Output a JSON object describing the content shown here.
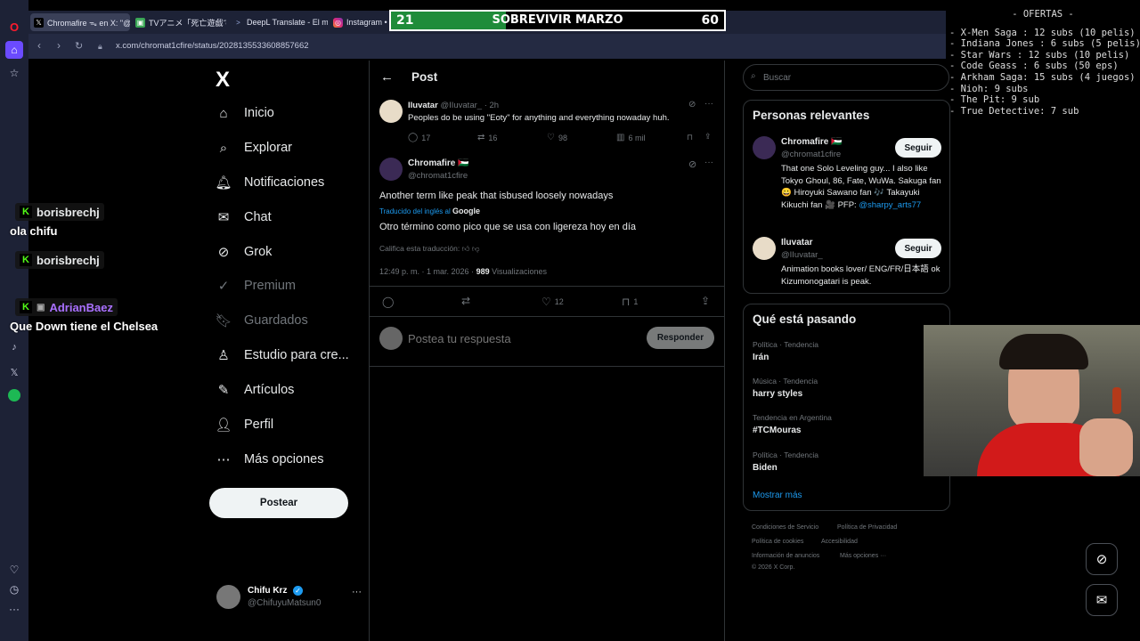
{
  "browser": {
    "tabs": [
      {
        "label": "Chromafire ᯓ en X: \"@IIu",
        "active": true,
        "icon": "x-icon"
      },
      {
        "label": "TVアニメ「死亡遊戯で飯を食",
        "active": false,
        "icon": "tv-icon"
      },
      {
        "label": "DeepL Translate - El mejor",
        "active": false,
        "icon": "deepl-icon"
      },
      {
        "label": "Instagram • M",
        "active": false,
        "icon": "instagram-icon"
      }
    ],
    "url": "x.com/chromat1cfire/status/2028135533608857662"
  },
  "score_bar": {
    "title": "SOBREVIVIR MARZO",
    "current": "21",
    "target": "60",
    "progress_fraction": 0.345,
    "fill_color": "#1f8c3a"
  },
  "offers": {
    "title": "- OFERTAS -",
    "lines": [
      "- X-Men Saga : 12 subs (10 pelis)",
      "- Indiana Jones : 6 subs (5 pelis)",
      "- Star Wars : 12 subs (10 pelis)",
      "- Code Geass : 6 subs (50 eps)",
      "- Arkham Saga: 15 subs (4 juegos)",
      "- Nioh: 9 subs",
      "- The Pit: 9 sub",
      "- True Detective: 7 sub"
    ]
  },
  "nav": {
    "logo": "X",
    "items": [
      {
        "label": "Inicio",
        "icon": "home-icon"
      },
      {
        "label": "Explorar",
        "icon": "search-icon"
      },
      {
        "label": "Notificaciones",
        "icon": "bell-icon"
      },
      {
        "label": "Chat",
        "icon": "mail-icon"
      },
      {
        "label": "Grok",
        "icon": "grok-icon"
      },
      {
        "label": "Premium",
        "icon": "premium-icon"
      },
      {
        "label": "Guardados",
        "icon": "bookmark-icon"
      },
      {
        "label": "Estudio para cre...",
        "icon": "studio-icon"
      },
      {
        "label": "Artículos",
        "icon": "articles-icon"
      },
      {
        "label": "Perfil",
        "icon": "person-icon"
      },
      {
        "label": "Más opciones",
        "icon": "more-circle-icon"
      }
    ],
    "post_button": "Postear",
    "account": {
      "name": "Chifu Krz",
      "handle": "@ChifuyuMatsun0"
    }
  },
  "post_header": {
    "back": "←",
    "title": "Post"
  },
  "reply_tweet": {
    "name": "Iluvatar",
    "handle": "@IIuvatar_",
    "time": "· 2h",
    "text": "Peoples do be using \"Eoty\" for anything and everything nowaday huh.",
    "replies": "17",
    "reposts": "16",
    "likes": "98",
    "views": "6 mil"
  },
  "main_tweet": {
    "name": "Chromafire",
    "flag": "🇵🇸",
    "handle": "@chromat1cfire",
    "text": "Another term like peak that isbused loosely nowadays",
    "translated_by": "Traducido del inglés al",
    "translator": "Google",
    "translation": "Otro término como pico que se usa con ligereza hoy en día",
    "rate_translation": "Califica esta traducción:",
    "timestamp": "12:49 p. m. · 1 mar. 2026 ·",
    "views_count": "989",
    "views_label": "Visualizaciones",
    "likes": "12",
    "bookmarks": "1"
  },
  "reply_box": {
    "placeholder": "Postea tu respuesta",
    "button": "Responder"
  },
  "search": {
    "placeholder": "Buscar"
  },
  "relevant": {
    "title": "Personas relevantes",
    "people": [
      {
        "name": "Chromafire 🇵🇸",
        "handle": "@chromat1cfire",
        "bio": "That one Solo Leveling guy... I also like Tokyo Ghoul, 86, Fate, WuWa. Sakuga fan 😀 Hiroyuki Sawano fan 🎶 Takayuki Kikuchi fan 🎥 PFP:",
        "link": "@sharpy_arts77",
        "follow": "Seguir"
      },
      {
        "name": "Iluvatar",
        "handle": "@IIuvatar_",
        "bio": "Animation books lover/ ENG/FR/日本語 ok Kizumonogatari is peak.",
        "link": "",
        "follow": "Seguir"
      }
    ]
  },
  "trending": {
    "title": "Qué está pasando",
    "items": [
      {
        "category": "Política · Tendencia",
        "name": "Irán"
      },
      {
        "category": "Música · Tendencia",
        "name": "harry styles"
      },
      {
        "category": "Tendencia en Argentina",
        "name": "#TCMouras"
      },
      {
        "category": "Política · Tendencia",
        "name": "Biden"
      }
    ],
    "show_more": "Mostrar más"
  },
  "footer": {
    "links": [
      "Condiciones de Servicio",
      "Política de Privacidad",
      "Política de cookies",
      "Accesibilidad",
      "Información de anuncios",
      "Más opciones ···"
    ],
    "copyright": "© 2026 X Corp."
  },
  "chat": [
    {
      "user": "borisbrechj",
      "color": "#ffffff",
      "message": "ola chifu"
    },
    {
      "user": "borisbrechj",
      "color": "#ffffff",
      "message": ""
    },
    {
      "user": "AdrianBaez",
      "color": "#a970ff",
      "message": "Que Down tiene el Chelsea"
    }
  ],
  "colors": {
    "accent": "#1d9bf0",
    "x_bg": "#000000",
    "opera_bar": "#1d2236"
  }
}
